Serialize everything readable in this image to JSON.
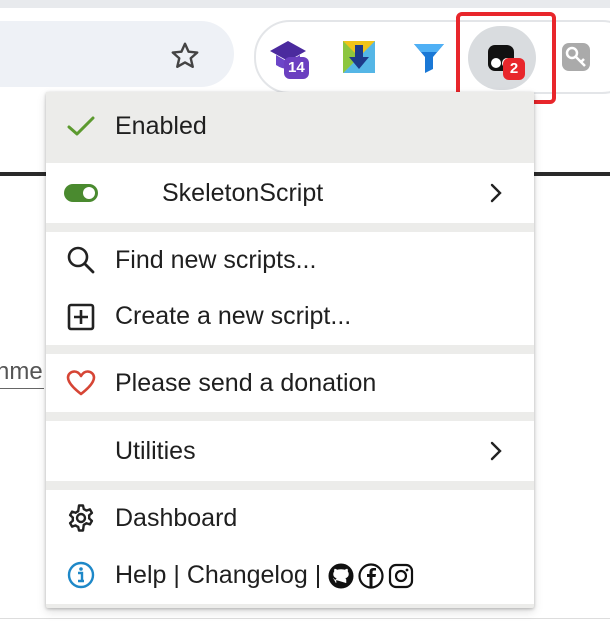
{
  "toolbar": {
    "bookmark_star": "star-icon",
    "extensions": [
      {
        "name": "graduation-cap-extension",
        "badge": "14",
        "badge_color": "#6b3fc0"
      },
      {
        "name": "download-extension",
        "badge": null
      },
      {
        "name": "filter-extension",
        "badge": null
      },
      {
        "name": "tampermonkey-extension",
        "badge": "2",
        "badge_color": "#e8262b"
      },
      {
        "name": "key-extension",
        "badge": null
      }
    ],
    "highlight_color": "#e8262b"
  },
  "page": {
    "fragment_text": "nmer"
  },
  "menu": {
    "enabled_label": "Enabled",
    "script_name": "SkeletonScript",
    "find_label": "Find new scripts...",
    "create_label": "Create a new script...",
    "donate_label": "Please send a donation",
    "utilities_label": "Utilities",
    "dashboard_label": "Dashboard",
    "help_label": "Help",
    "separator": "|",
    "changelog_label": "Changelog",
    "separator2": "|",
    "social_icons": [
      "github-icon",
      "facebook-icon",
      "instagram-icon"
    ],
    "colors": {
      "check": "#5c9a2f",
      "toggle": "#4a8a2f",
      "heart": "#d64535",
      "info": "#1e88c8"
    }
  }
}
